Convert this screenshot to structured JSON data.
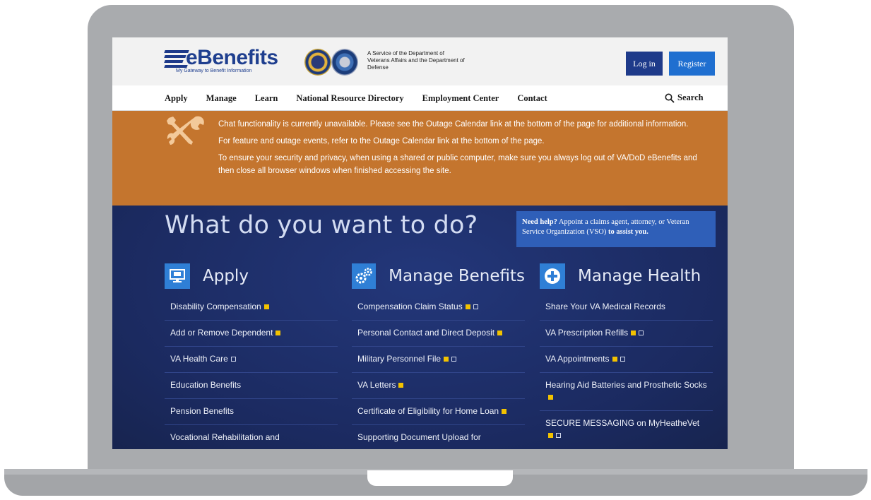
{
  "header": {
    "logo_text": "eBenefits",
    "logo_tagline": "My Gateway to Benefit Information",
    "agency_note": "A Service of the Department of Veterans Affairs and the Department of Defense",
    "login_label": "Log in",
    "register_label": "Register"
  },
  "nav": {
    "items": [
      "Apply",
      "Manage",
      "Learn",
      "National Resource Directory",
      "Employment Center",
      "Contact"
    ],
    "search_label": "Search"
  },
  "alert": {
    "messages": [
      "Chat functionality is currently unavailable. Please see the Outage Calendar link at the bottom of the page for additional information.",
      "For feature and outage events, refer to the Outage Calendar link at the bottom of the page.",
      "To ensure your security and privacy, when using a shared or public computer, make sure you always log out of VA/DoD eBenefits and then close all browser windows when finished accessing the site."
    ]
  },
  "main": {
    "title": "What do you want to do?",
    "help": {
      "lead": "Need help?",
      "text": " Appoint a claims agent, attorney, or Veteran Service Organization (VSO) ",
      "tail": "to assist you."
    },
    "columns": [
      {
        "title": "Apply",
        "icon": "monitor-icon",
        "items": [
          "Disability Compensation",
          "Add or Remove Dependent",
          "VA Health Care",
          "Education Benefits",
          "Pension Benefits",
          "Vocational Rehabilitation and"
        ]
      },
      {
        "title": "Manage Benefits",
        "icon": "gears-icon",
        "items": [
          "Compensation Claim Status",
          "Personal Contact and Direct Deposit",
          "Military Personnel File",
          "VA Letters",
          "Certificate of Eligibility for Home Loan",
          "Supporting Document Upload for"
        ]
      },
      {
        "title": "Manage Health",
        "icon": "plus-circle-icon",
        "items": [
          "Share Your VA Medical Records",
          "VA Prescription Refills",
          "VA Appointments",
          "Hearing Aid Batteries and Prosthetic Socks",
          "SECURE MESSAGING on MyHeatheVet"
        ]
      }
    ]
  },
  "colors": {
    "alert_bg": "#c4752e",
    "main_bg": "#1c2d63",
    "primary_button": "#1e3a8a",
    "register_button": "#1f6fd0",
    "help_box": "#2f5fb8",
    "column_icon_bg": "#2f7fd6"
  }
}
